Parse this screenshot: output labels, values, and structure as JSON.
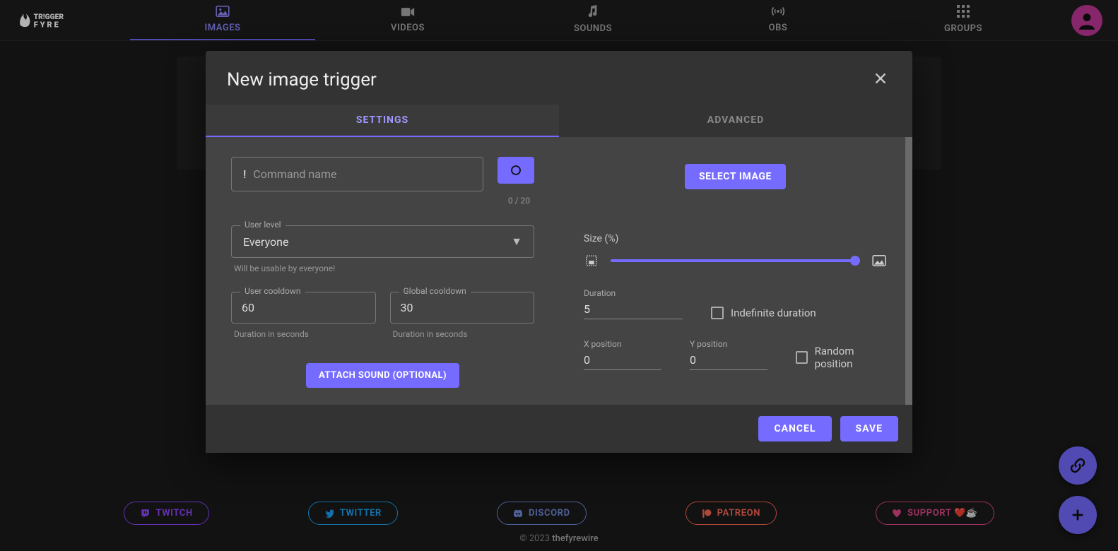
{
  "nav": {
    "items": [
      {
        "id": "images",
        "label": "IMAGES",
        "icon": "image-icon"
      },
      {
        "id": "videos",
        "label": "VIDEOS",
        "icon": "video-icon"
      },
      {
        "id": "sounds",
        "label": "SOUNDS",
        "icon": "sound-icon"
      },
      {
        "id": "obs",
        "label": "OBS",
        "icon": "broadcast-icon"
      },
      {
        "id": "groups",
        "label": "GROUPS",
        "icon": "grid-icon"
      }
    ],
    "active": "images"
  },
  "modal": {
    "title": "New image trigger",
    "tabs": {
      "settings": "SETTINGS",
      "advanced": "ADVANCED",
      "active": "settings"
    },
    "command": {
      "prefix": "!",
      "placeholder": "Command name",
      "value": "",
      "counter": "0 / 20"
    },
    "userLevel": {
      "legend": "User level",
      "value": "Everyone",
      "hint": "Will be usable by everyone!"
    },
    "userCooldown": {
      "legend": "User cooldown",
      "value": "60",
      "hint": "Duration in seconds"
    },
    "globalCooldown": {
      "legend": "Global cooldown",
      "value": "30",
      "hint": "Duration in seconds"
    },
    "attachSound": "ATTACH SOUND (OPTIONAL)",
    "selectImage": "SELECT IMAGE",
    "size": {
      "label": "Size (%)",
      "value": 100
    },
    "duration": {
      "label": "Duration",
      "value": "5",
      "indef_label": "Indefinite duration",
      "indef_checked": false
    },
    "xpos": {
      "label": "X position",
      "value": "0"
    },
    "ypos": {
      "label": "Y position",
      "value": "0"
    },
    "randomPos": {
      "label": "Random position",
      "checked": false
    },
    "buttons": {
      "cancel": "CANCEL",
      "save": "SAVE"
    }
  },
  "footer": {
    "links": {
      "twitch": "TWITCH",
      "twitter": "TWITTER",
      "discord": "DISCORD",
      "patreon": "PATREON",
      "support": "SUPPORT ❤️☕"
    },
    "copyright_prefix": "© 2023 ",
    "copyright_brand": "thefyrewire"
  },
  "colors": {
    "accent": "#756bff",
    "pink": "#c2379a"
  }
}
